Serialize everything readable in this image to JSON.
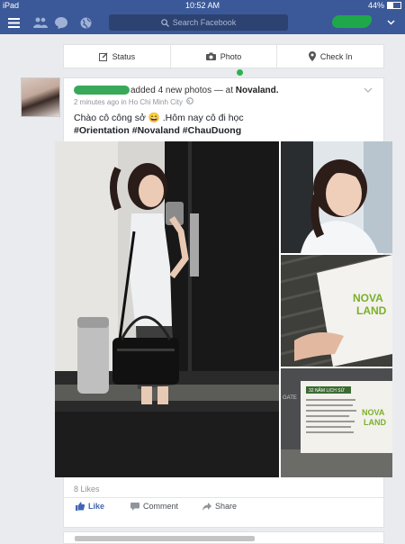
{
  "status_bar": {
    "device": "iPad",
    "time": "10:52 AM",
    "battery": "44%",
    "battery_level": 0.44
  },
  "navbar": {
    "search_placeholder": "Search Facebook"
  },
  "composer": {
    "status": "Status",
    "photo": "Photo",
    "checkin": "Check In"
  },
  "post": {
    "action": "added 4 new photos — at ",
    "place": "Novaland.",
    "time": "2 minutes ago in Ho Chi Minh City",
    "caption": "Chào cô công sở 😄 .Hôm nay cô đi học",
    "hashtags": "#Orientation #Novaland #ChauDuong",
    "likes": "8 Likes",
    "like_label": "Like",
    "comment_label": "Comment",
    "share_label": "Share"
  },
  "photos": {
    "logo_top": "NOVA",
    "logo_bottom": "LAND",
    "poster_title": "32 NĂM LỊCH SỬ",
    "poster_logo_top": "NOVA",
    "poster_logo_bottom": "LAND",
    "gate_text": "GATE"
  },
  "colors": {
    "brand": "#3b5998",
    "link": "#4267b2",
    "online": "#2ab34b"
  }
}
